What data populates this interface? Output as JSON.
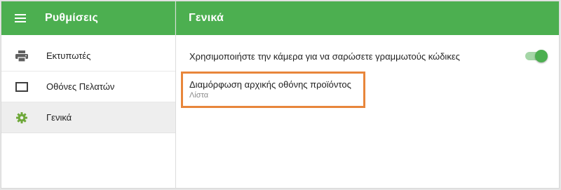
{
  "colors": {
    "primary": "#4caf50",
    "active_icon": "#6fa83a",
    "highlight_border": "#e8863b"
  },
  "sidebar": {
    "title": "Ρυθμίσεις",
    "menu_icon": "hamburger-menu-icon",
    "items": [
      {
        "label": "Εκτυπωτές",
        "icon": "printer-icon",
        "active": false
      },
      {
        "label": "Οθόνες Πελατών",
        "icon": "monitor-icon",
        "active": false
      },
      {
        "label": "Γενικά",
        "icon": "gear-icon",
        "active": true
      }
    ]
  },
  "main": {
    "title": "Γενικά",
    "settings": {
      "camera_barcode": {
        "label": "Χρησιμοποιήστε την κάμερα για να σαρώσετε γραμμωτούς κώδικες",
        "enabled": true
      },
      "home_screen": {
        "title": "Διαμόρφωση αρχικής οθόνης προϊόντος",
        "value": "Λίστα"
      }
    }
  }
}
